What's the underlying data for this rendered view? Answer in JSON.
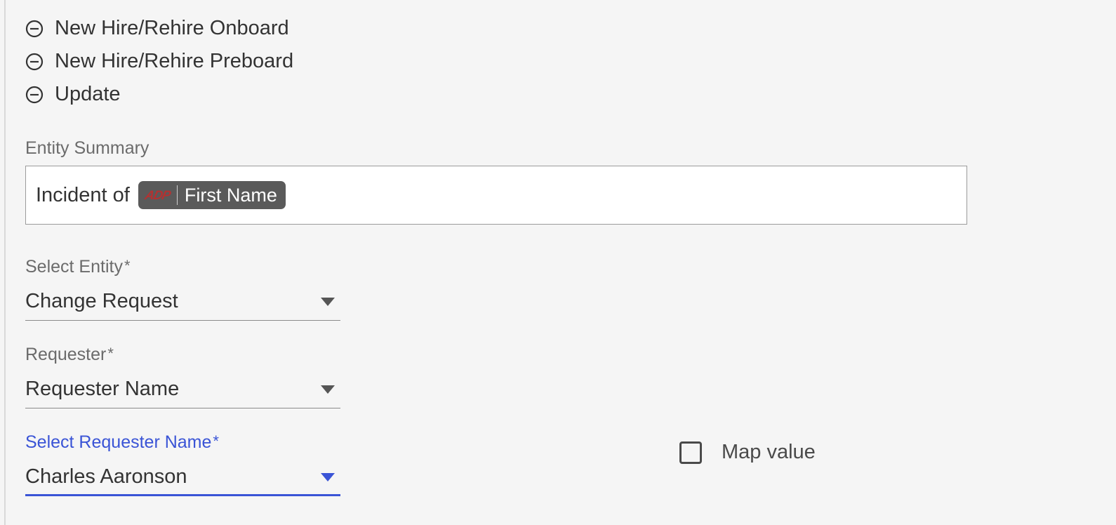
{
  "list_items": [
    {
      "label": "New Hire/Rehire Onboard"
    },
    {
      "label": "New Hire/Rehire Preboard"
    },
    {
      "label": "Update"
    }
  ],
  "entity_summary": {
    "label": "Entity Summary",
    "prefix_text": "Incident of",
    "chip_logo": "ADP",
    "chip_field": "First Name"
  },
  "select_entity": {
    "label": "Select Entity",
    "required_star": "*",
    "value": "Change Request"
  },
  "requester": {
    "label": "Requester",
    "required_star": "*",
    "value": "Requester Name"
  },
  "select_requester_name": {
    "label": "Select Requester Name",
    "required_star": "*",
    "value": "Charles Aaronson"
  },
  "map_value": {
    "label": "Map value",
    "checked": false
  }
}
